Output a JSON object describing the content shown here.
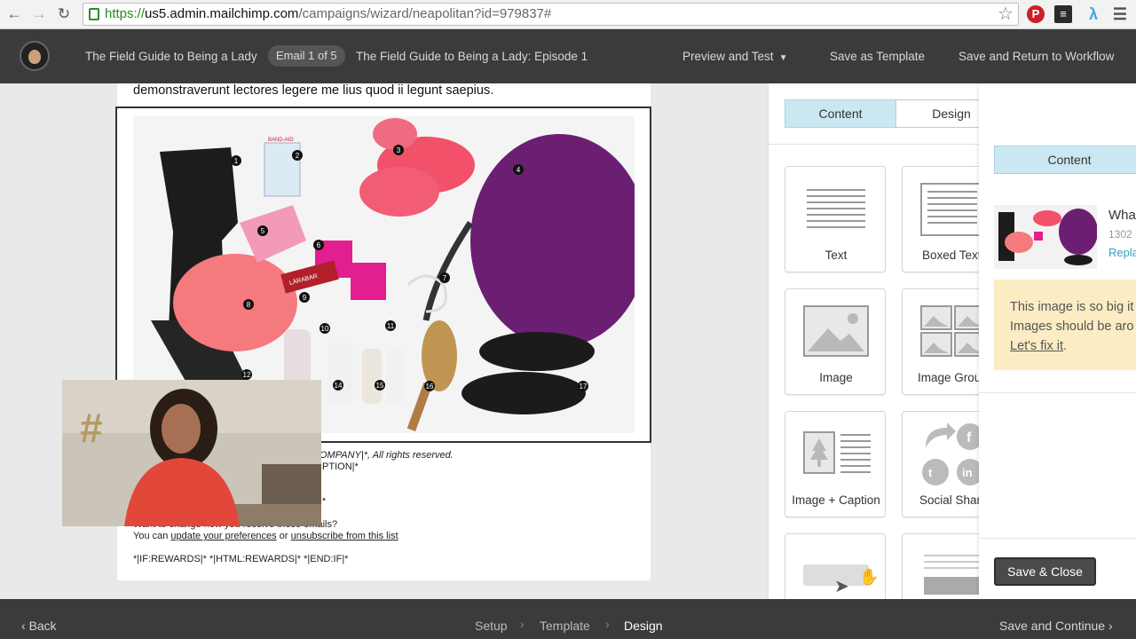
{
  "browser": {
    "url_scheme": "https://",
    "url_host": "us5.admin.mailchimp.com",
    "url_path": "/campaigns/wizard/neapolitan?id=979837#",
    "icons": [
      "back-arrow-icon",
      "forward-arrow-icon",
      "reload-icon",
      "star-icon",
      "pinterest-icon",
      "buffer-icon",
      "extension-icon",
      "menu-icon"
    ]
  },
  "header": {
    "campaign_name": "The Field Guide to Being a Lady",
    "email_pill": "Email 1 of 5",
    "email_title": "The Field Guide to Being a Lady: Episode 1",
    "preview_test": "Preview and Test",
    "save_template": "Save as Template",
    "save_return": "Save and Return to Workflow"
  },
  "email": {
    "top_text": "demonstraverunt lectores legere me lius quod ii legunt saepius.",
    "footer": {
      "copyright": "OMPANY|*, All rights reserved.",
      "description": "IPTION|*",
      "list_frag": "|*",
      "want_change": "Want to change how you receive these emails?",
      "you_can": "You can",
      "update_prefs": "update your preferences",
      "or": "or",
      "unsubscribe": "unsubscribe from this list",
      "rewards": "*|IF:REWARDS|* *|HTML:REWARDS|* *|END:IF|*"
    },
    "photo_numbers": [
      "1",
      "2",
      "3",
      "4",
      "5",
      "6",
      "7",
      "8",
      "9",
      "10",
      "11",
      "12",
      "14",
      "15",
      "16",
      "17"
    ],
    "bandaid_text": "BAND-AID",
    "bar_text": "LÄRABAR"
  },
  "blocks_panel": {
    "tabs": {
      "content": "Content",
      "design": "Design"
    },
    "tiles": [
      {
        "label": "Text",
        "icon": "text-block-icon"
      },
      {
        "label": "Boxed Text",
        "icon": "boxed-text-block-icon"
      },
      {
        "label": "Image",
        "icon": "image-block-icon"
      },
      {
        "label": "Image Group",
        "icon": "image-group-block-icon"
      },
      {
        "label": "Image + Caption",
        "icon": "image-caption-block-icon"
      },
      {
        "label": "Social Share",
        "icon": "social-share-block-icon"
      },
      {
        "label": "",
        "icon": "button-block-icon"
      },
      {
        "label": "",
        "icon": "divider-block-icon"
      }
    ]
  },
  "right_panel": {
    "tab": "Content",
    "image_name": "What",
    "image_size": "1302",
    "replace": "Replace",
    "warning_line1": "This image is so big it",
    "warning_line2": "Images should be aro",
    "warning_fix": "Let's fix it",
    "warning_end": ".",
    "save_close": "Save & Close"
  },
  "bottom": {
    "back": "Back",
    "steps": [
      "Setup",
      "Template",
      "Design"
    ],
    "save_continue": "Save and Continue"
  },
  "colors": {
    "header_bg": "#3b3b3b",
    "tab_active": "#cbe8f2",
    "link_blue": "#3a9fc6",
    "warning_bg": "#fbecc4",
    "url_green": "#1f8d1f"
  }
}
